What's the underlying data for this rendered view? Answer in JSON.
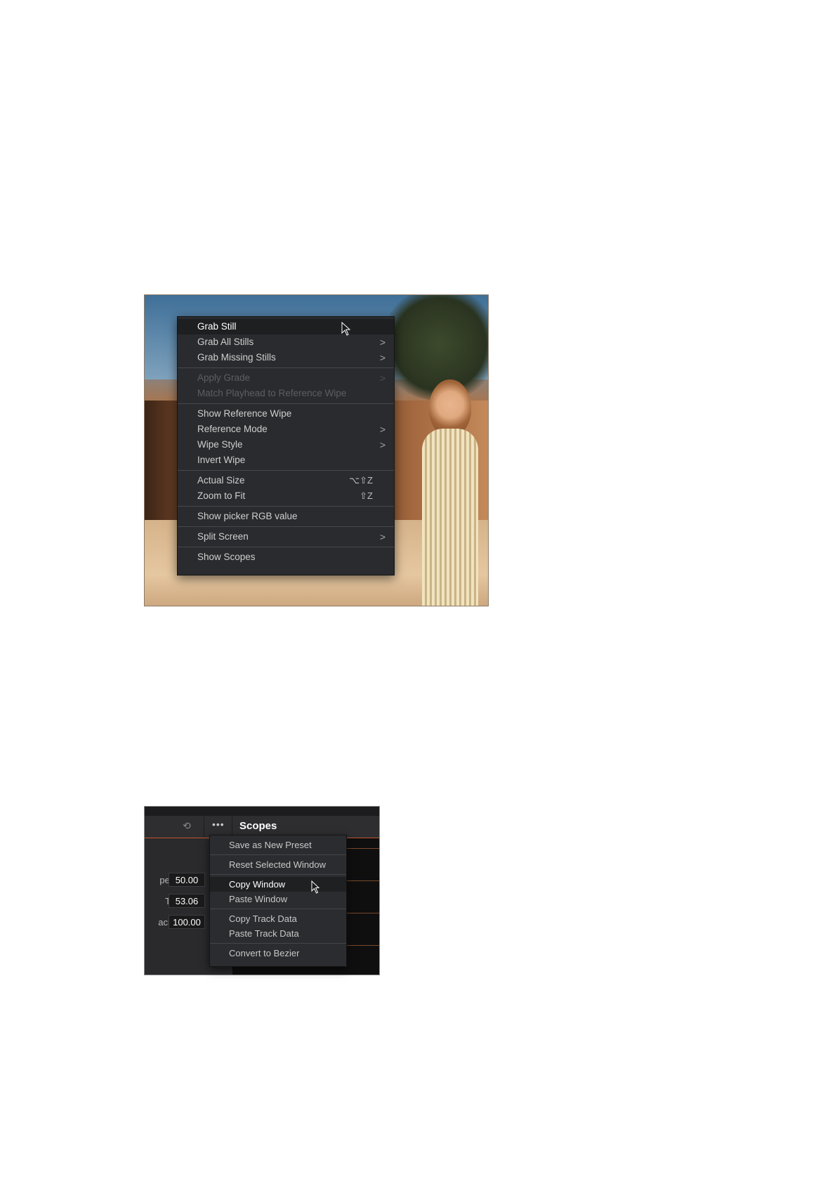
{
  "viewer_menu": {
    "items": [
      {
        "label": "Grab Still",
        "highlighted": true
      },
      {
        "label": "Grab All Stills",
        "arrow": ">"
      },
      {
        "label": "Grab Missing Stills",
        "arrow": ">"
      },
      {
        "label": "Apply Grade",
        "arrow": ">",
        "disabled": true
      },
      {
        "label": "Match Playhead to Reference Wipe",
        "disabled": true
      },
      {
        "label": "Show Reference Wipe"
      },
      {
        "label": "Reference Mode",
        "arrow": ">"
      },
      {
        "label": "Wipe Style",
        "arrow": ">"
      },
      {
        "label": "Invert Wipe"
      },
      {
        "label": "Actual Size",
        "shortcut": "⌥⇧Z"
      },
      {
        "label": "Zoom to Fit",
        "shortcut": "⇧Z"
      },
      {
        "label": "Show picker RGB value"
      },
      {
        "label": "Split Screen",
        "arrow": ">"
      },
      {
        "label": "Show Scopes"
      }
    ]
  },
  "window_panel": {
    "title": "Scopes",
    "dots": "•••",
    "params": [
      {
        "label": "pect",
        "value": "50.00"
      },
      {
        "label": "Tilt",
        "value": "53.06"
      },
      {
        "label": "acity",
        "value": "100.00"
      }
    ]
  },
  "window_menu": {
    "items": [
      {
        "label": "Save as New Preset"
      },
      {
        "label": "Reset Selected Window"
      },
      {
        "label": "Copy Window",
        "highlighted": true
      },
      {
        "label": "Paste Window"
      },
      {
        "label": "Copy Track Data"
      },
      {
        "label": "Paste Track Data"
      },
      {
        "label": "Convert to Bezier"
      }
    ]
  },
  "colors": {
    "menu_bg": "#2a2b2e",
    "menu_highlight": "#1e1f21",
    "accent_line": "#c4552e"
  }
}
